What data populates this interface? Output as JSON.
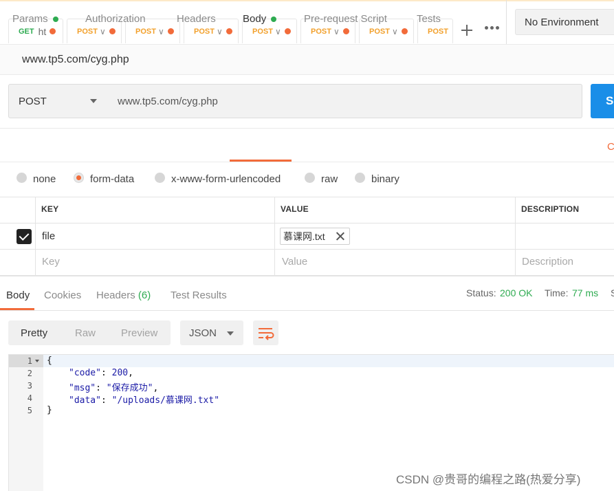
{
  "tabs": [
    {
      "method": "GET",
      "name": "ht",
      "chevron": "",
      "modified": true,
      "method_color": "#2eab51"
    },
    {
      "method": "POST",
      "name": "",
      "chevron": "∨",
      "modified": true,
      "method_color": "#f2a02b"
    },
    {
      "method": "POST",
      "name": "",
      "chevron": "∨",
      "modified": true,
      "method_color": "#f2a02b"
    },
    {
      "method": "POST",
      "name": "",
      "chevron": "∨",
      "modified": true,
      "method_color": "#f2a02b"
    },
    {
      "method": "POST",
      "name": "",
      "chevron": "∨",
      "modified": true,
      "method_color": "#f2a02b"
    },
    {
      "method": "POST",
      "name": "",
      "chevron": "∨",
      "modified": true,
      "method_color": "#f2a02b"
    },
    {
      "method": "POST",
      "name": "",
      "chevron": "∨",
      "modified": true,
      "method_color": "#f2a02b"
    },
    {
      "method": "POST",
      "name": "",
      "chevron": "",
      "modified": false,
      "method_color": "#f2a02b"
    }
  ],
  "toolbar": {
    "add_icon": "plus-icon",
    "more_icon": "ellipsis-icon"
  },
  "environment": {
    "selected": "No Environment"
  },
  "request": {
    "title": "www.tp5.com/cyg.php",
    "method": "POST",
    "url": "www.tp5.com/cyg.php",
    "send_label": "Se"
  },
  "request_tabs": [
    {
      "label": "Params",
      "dot": true
    },
    {
      "label": "Authorization",
      "dot": false
    },
    {
      "label": "Headers",
      "dot": false
    },
    {
      "label": "Body",
      "dot": true,
      "active": true
    },
    {
      "label": "Pre-request Script",
      "dot": false
    },
    {
      "label": "Tests",
      "dot": false
    }
  ],
  "request_tabs_cut": "C",
  "body_types": [
    {
      "label": "none",
      "selected": false
    },
    {
      "label": "form-data",
      "selected": true
    },
    {
      "label": "x-www-form-urlencoded",
      "selected": false
    },
    {
      "label": "raw",
      "selected": false
    },
    {
      "label": "binary",
      "selected": false
    }
  ],
  "table": {
    "headers": {
      "key": "KEY",
      "value": "VALUE",
      "description": "DESCRIPTION"
    },
    "rows": [
      {
        "checked": true,
        "key": "file",
        "value": "慕课网.txt",
        "description": ""
      }
    ],
    "placeholders": {
      "key": "Key",
      "value": "Value",
      "description": "Description"
    }
  },
  "response": {
    "tabs": {
      "body": "Body",
      "cookies": "Cookies",
      "headers": "Headers",
      "headers_count": "(6)",
      "tests": "Test Results"
    },
    "status_label": "Status:",
    "status_value": "200 OK",
    "time_label": "Time:",
    "time_value": "77 ms",
    "cut_char": "S",
    "view_modes": {
      "pretty": "Pretty",
      "raw": "Raw",
      "preview": "Preview"
    },
    "format": "JSON",
    "wrap_icon": "wrap-lines-icon",
    "line_numbers": [
      "1",
      "2",
      "3",
      "4",
      "5"
    ],
    "code": {
      "open": "{",
      "code_key": "\"code\"",
      "code_val": "200",
      "msg_key": "\"msg\"",
      "msg_val": "\"保存成功\"",
      "data_key": "\"data\"",
      "data_val": "\"/uploads/慕课网.txt\"",
      "close": "}"
    }
  },
  "watermark": "CSDN @贵哥的编程之路(热爱分享)",
  "colors": {
    "accent": "#f26b3a",
    "success": "#2eab51",
    "send": "#1a8ee8",
    "post": "#f2a02b"
  }
}
